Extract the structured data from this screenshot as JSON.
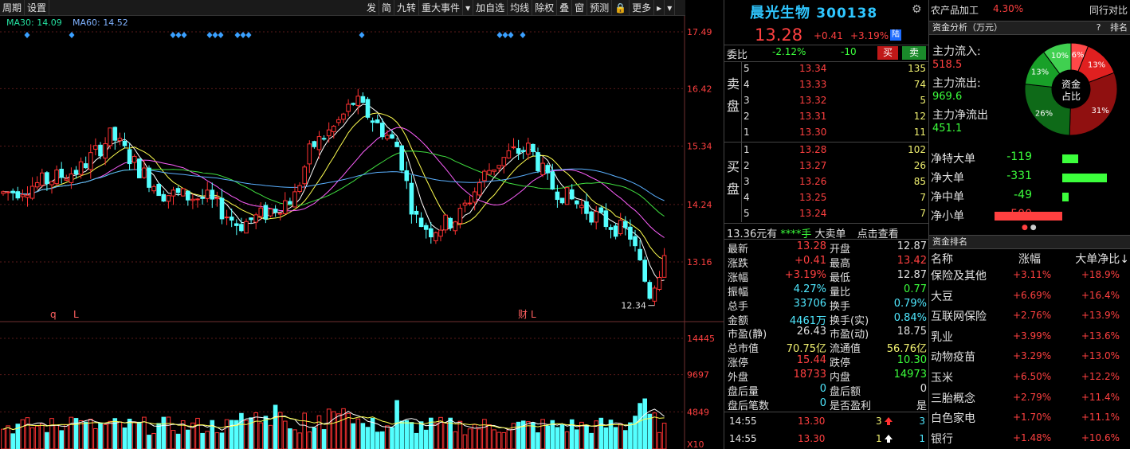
{
  "toolbar": {
    "left": [
      "周期",
      "设置"
    ],
    "right": [
      "发",
      "简",
      "九转",
      "重大事件",
      "▾",
      "加自选",
      "均线",
      "除权",
      "叠",
      "窗",
      "预测",
      "🔒",
      "更多",
      "▸",
      "▾"
    ]
  },
  "chart": {
    "ma30_label": "MA30: 14.09",
    "ma60_label": "MA60: 14.52",
    "price_ticks": [
      "17.49",
      "16.42",
      "15.34",
      "14.24",
      "13.16"
    ],
    "volume_ticks": [
      "14445",
      "9697",
      "4849"
    ],
    "volume_unit": "X10",
    "low_marker": "12.34",
    "event_q": "q",
    "event_l1": "L",
    "event_cai": "财",
    "event_l2": "L",
    "colors": {
      "up": "#ff3232",
      "down": "#54ffff",
      "ma_white": "#ffffff",
      "ma_yellow": "#ffff50",
      "ma_magenta": "#ff60ff",
      "ma_green": "#40e040",
      "ma_blue": "#5ab0ff",
      "grid": "#5a1a1a"
    }
  },
  "quote": {
    "name": "晨光生物",
    "code": "300138",
    "price": "13.28",
    "change": "+0.41",
    "change_pct": "+3.19%",
    "exchange_badge": "陆",
    "weibi_label": "委比",
    "weibi_pct": "-2.12%",
    "weibi_diff": "-10",
    "buy_btn": "买",
    "sell_btn": "卖",
    "sell_side_label": "卖盘",
    "buy_side_label": "买盘",
    "asks": [
      {
        "lvl": "5",
        "px": "13.34",
        "vol": "135"
      },
      {
        "lvl": "4",
        "px": "13.33",
        "vol": "74"
      },
      {
        "lvl": "3",
        "px": "13.32",
        "vol": "5"
      },
      {
        "lvl": "2",
        "px": "13.31",
        "vol": "12"
      },
      {
        "lvl": "1",
        "px": "13.30",
        "vol": "11"
      }
    ],
    "bids": [
      {
        "lvl": "1",
        "px": "13.28",
        "vol": "102"
      },
      {
        "lvl": "2",
        "px": "13.27",
        "vol": "26"
      },
      {
        "lvl": "3",
        "px": "13.26",
        "vol": "85"
      },
      {
        "lvl": "4",
        "px": "13.25",
        "vol": "7"
      },
      {
        "lvl": "5",
        "px": "13.24",
        "vol": "7"
      }
    ],
    "big_order_price": "13.36元有",
    "big_order_qty": "****手",
    "big_order_label": "大卖单",
    "big_order_link": "点击查看",
    "stats": [
      {
        "k1": "最新",
        "v1": "13.28",
        "c1": "red",
        "k2": "开盘",
        "v2": "12.87",
        "c2": "wht"
      },
      {
        "k1": "涨跌",
        "v1": "+0.41",
        "c1": "red",
        "k2": "最高",
        "v2": "13.42",
        "c2": "red"
      },
      {
        "k1": "涨幅",
        "v1": "+3.19%",
        "c1": "red",
        "k2": "最低",
        "v2": "12.87",
        "c2": "wht"
      },
      {
        "k1": "振幅",
        "v1": "4.27%",
        "c1": "cyan",
        "k2": "量比",
        "v2": "0.77",
        "c2": "grn"
      },
      {
        "k1": "总手",
        "v1": "33706",
        "c1": "cyan",
        "k2": "换手",
        "v2": "0.79%",
        "c2": "cyan"
      },
      {
        "k1": "金额",
        "v1": "4461万",
        "c1": "cyan",
        "k2": "换手(实)",
        "v2": "0.84%",
        "c2": "cyan"
      },
      {
        "k1": "市盈(静)",
        "v1": "26.43",
        "c1": "wht",
        "k2": "市盈(动)",
        "v2": "18.75",
        "c2": "wht"
      },
      {
        "k1": "总市值",
        "v1": "70.75亿",
        "c1": "yel",
        "k2": "流通值",
        "v2": "56.76亿",
        "c2": "yel"
      },
      {
        "k1": "涨停",
        "v1": "15.44",
        "c1": "red",
        "k2": "跌停",
        "v2": "10.30",
        "c2": "grn"
      },
      {
        "k1": "外盘",
        "v1": "18733",
        "c1": "red",
        "k2": "内盘",
        "v2": "14973",
        "c2": "grn"
      },
      {
        "k1": "盘后量",
        "v1": "0",
        "c1": "cyan",
        "k2": "盘后额",
        "v2": "0",
        "c2": "wht"
      },
      {
        "k1": "盘后笔数",
        "v1": "0",
        "c1": "cyan",
        "k2": "是否盈利",
        "v2": "是",
        "c2": "wht"
      }
    ],
    "ticks": [
      {
        "t": "14:55",
        "p": "13.30",
        "n": "3",
        "dir": "up",
        "c": "3"
      },
      {
        "t": "14:55",
        "p": "13.30",
        "n": "1",
        "dir": "up-white",
        "c": "1"
      }
    ]
  },
  "fund": {
    "sector": "农产品加工",
    "sector_pct": "4.30%",
    "compare": "同行对比",
    "analysis_title": "资金分析（万元）",
    "analysis_help": "?",
    "analysis_rank": "排名",
    "inflow_label": "主力流入:",
    "inflow_value": "518.5",
    "outflow_label": "主力流出:",
    "outflow_value": "969.6",
    "net_label": "主力净流出",
    "net_value": "451.1",
    "donut_center": "资金",
    "donut_center2": "占比",
    "donut": [
      {
        "pct": 6,
        "label": "6%",
        "color": "#ff4848"
      },
      {
        "pct": 13,
        "label": "13%",
        "color": "#e02020"
      },
      {
        "pct": 31,
        "label": "31%",
        "color": "#901010"
      },
      {
        "pct": 26,
        "label": "26%",
        "color": "#0e6a18"
      },
      {
        "pct": 13,
        "label": "13%",
        "color": "#18a028"
      },
      {
        "pct": 10,
        "label": "10%",
        "color": "#40d050"
      }
    ],
    "net_rows": [
      {
        "k": "净特大单",
        "v": "-119",
        "val": -119,
        "color": "#3cff3c"
      },
      {
        "k": "净大单",
        "v": "-331",
        "val": -331,
        "color": "#3cff3c"
      },
      {
        "k": "净中单",
        "v": "-49",
        "val": -49,
        "color": "#3cff3c"
      },
      {
        "k": "净小单",
        "v": "500",
        "val": 500,
        "color": "#ff4040"
      }
    ],
    "rank_title": "资金排名",
    "rank_head": {
      "name": "名称",
      "a": "涨幅",
      "b": "大单净比↓"
    },
    "rank_rows": [
      {
        "nm": "保险及其他",
        "a": "+3.11%",
        "b": "+18.9%"
      },
      {
        "nm": "大豆",
        "a": "+6.69%",
        "b": "+16.4%"
      },
      {
        "nm": "互联网保险",
        "a": "+2.76%",
        "b": "+13.9%"
      },
      {
        "nm": "乳业",
        "a": "+3.99%",
        "b": "+13.6%"
      },
      {
        "nm": "动物疫苗",
        "a": "+3.29%",
        "b": "+13.0%"
      },
      {
        "nm": "玉米",
        "a": "+6.50%",
        "b": "+12.2%"
      },
      {
        "nm": "三胎概念",
        "a": "+2.79%",
        "b": "+11.4%"
      },
      {
        "nm": "白色家电",
        "a": "+1.70%",
        "b": "+11.1%"
      },
      {
        "nm": "银行",
        "a": "+1.48%",
        "b": "+10.6%"
      }
    ]
  }
}
